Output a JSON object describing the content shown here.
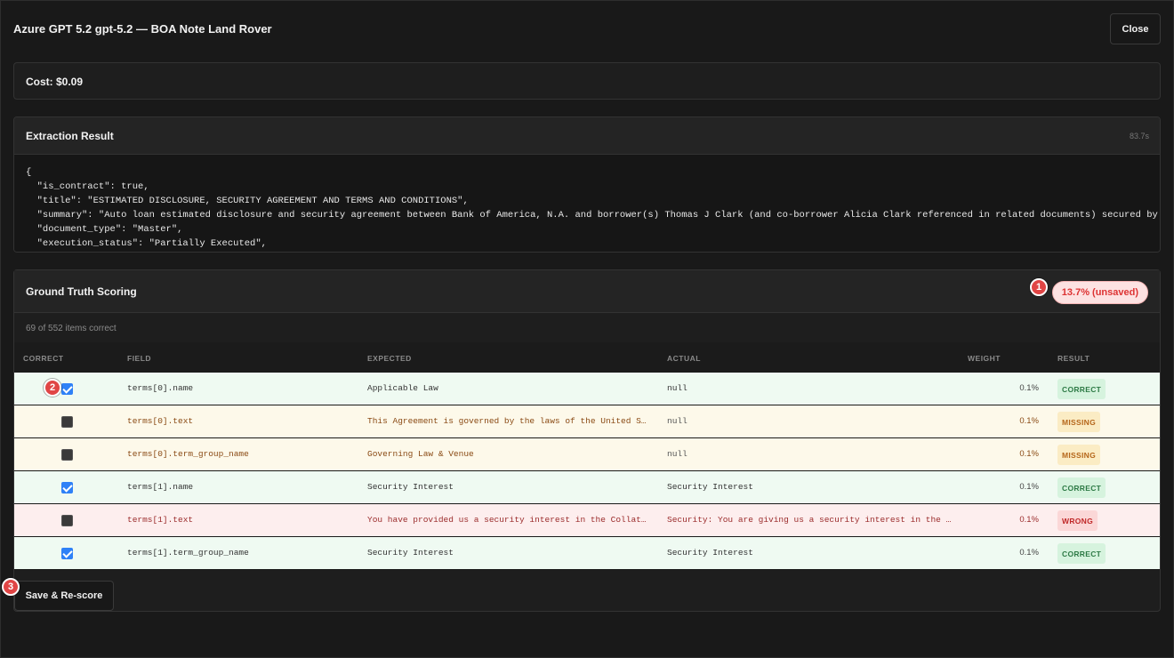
{
  "modal": {
    "title": "Azure GPT 5.2 gpt-5.2 — BOA Note Land Rover",
    "close_label": "Close"
  },
  "cost": {
    "label": "Cost: $0.09"
  },
  "extraction": {
    "title": "Extraction Result",
    "duration": "83.7s",
    "json_lines": [
      "{",
      "  \"is_contract\": true,",
      "  \"title\": \"ESTIMATED DISCLOSURE, SECURITY AGREEMENT AND TERMS AND CONDITIONS\",",
      "  \"summary\": \"Auto loan estimated disclosure and security agreement between Bank of America, N.A. and borrower(s) Thomas J Clark (and co-borrower Alicia Clark referenced in related documents) secured by",
      "  \"document_type\": \"Master\",",
      "  \"execution_status\": \"Partially Executed\","
    ]
  },
  "scoring": {
    "title": "Ground Truth Scoring",
    "score_badge": "13.7% (unsaved)",
    "items_count": "69 of 552 items correct",
    "columns": {
      "correct": "CORRECT",
      "field": "FIELD",
      "expected": "EXPECTED",
      "actual": "ACTUAL",
      "weight": "WEIGHT",
      "result": "RESULT"
    },
    "rows": [
      {
        "checked": true,
        "field": "terms[0].name",
        "expected": "Applicable Law",
        "actual": "null",
        "weight": "0.1%",
        "result": "CORRECT",
        "status": "correct"
      },
      {
        "checked": false,
        "field": "terms[0].text",
        "expected": "This Agreement is governed by the laws of the United States and the state of Illinois",
        "actual": "null",
        "weight": "0.1%",
        "result": "MISSING",
        "status": "missing"
      },
      {
        "checked": false,
        "field": "terms[0].term_group_name",
        "expected": "Governing Law & Venue",
        "actual": "null",
        "weight": "0.1%",
        "result": "MISSING",
        "status": "missing"
      },
      {
        "checked": true,
        "field": "terms[1].name",
        "expected": "Security Interest",
        "actual": "Security Interest",
        "weight": "0.1%",
        "result": "CORRECT",
        "status": "correct"
      },
      {
        "checked": false,
        "field": "terms[1].text",
        "expected": "You have provided us a security interest in the Collateral described",
        "actual": "Security: You are giving us a security interest in the vehicle being purchased",
        "weight": "0.1%",
        "result": "WRONG",
        "status": "wrong"
      },
      {
        "checked": true,
        "field": "terms[1].term_group_name",
        "expected": "Security Interest",
        "actual": "Security Interest",
        "weight": "0.1%",
        "result": "CORRECT",
        "status": "correct"
      }
    ],
    "save_label": "Save & Re-score"
  },
  "markers": [
    "1",
    "2",
    "3"
  ]
}
